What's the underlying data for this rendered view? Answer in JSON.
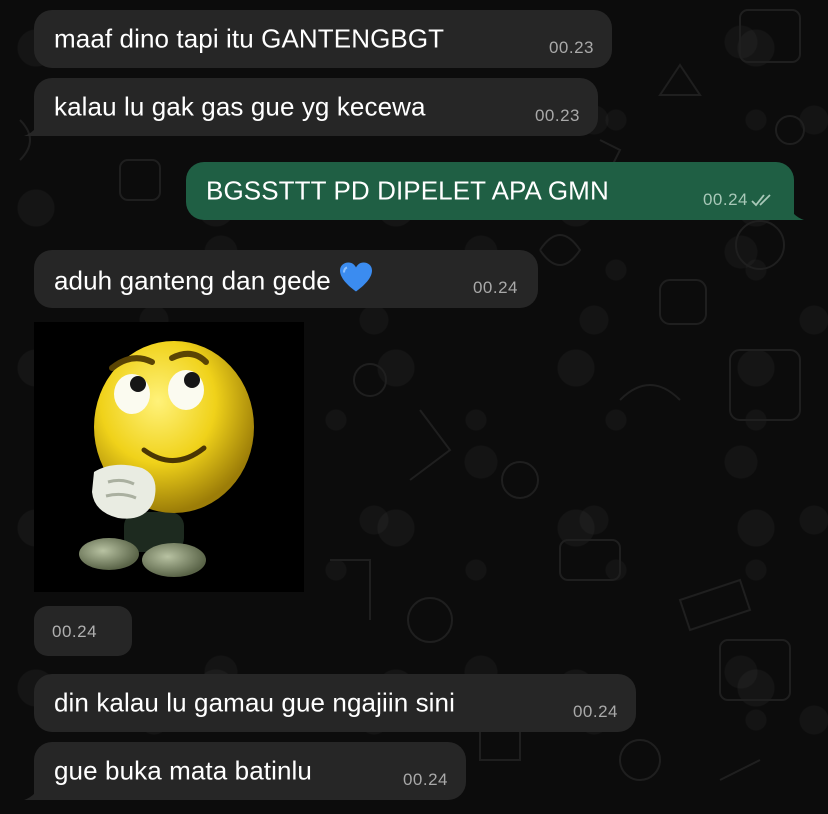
{
  "messages": [
    {
      "direction": "incoming",
      "text": "maaf dino tapi itu GANTENGBGT",
      "time": "00.23"
    },
    {
      "direction": "incoming",
      "text": "kalau lu gak gas gue yg kecewa",
      "time": "00.23"
    },
    {
      "direction": "outgoing",
      "text": "BGSSTTT PD DIPELET APA GMN",
      "time": "00.24",
      "status_icon": "double-check-icon"
    },
    {
      "direction": "incoming",
      "text": "aduh ganteng dan gede",
      "emoji": "blue-heart-icon",
      "time": "00.24"
    },
    {
      "direction": "incoming",
      "type": "sticker",
      "sticker": "thinking-smiley-sticker",
      "time": "00.24"
    },
    {
      "direction": "incoming",
      "text": "din kalau lu gamau gue ngajiin sini",
      "time": "00.24"
    },
    {
      "direction": "incoming",
      "text": "gue buka mata batinlu",
      "time": "00.24"
    }
  ],
  "colors": {
    "background": "#0c0c0c",
    "incoming_bubble": "#262626",
    "outgoing_bubble": "#1f5f44",
    "timestamp": "#a9a9a9",
    "heart": "#3b8cf0"
  }
}
